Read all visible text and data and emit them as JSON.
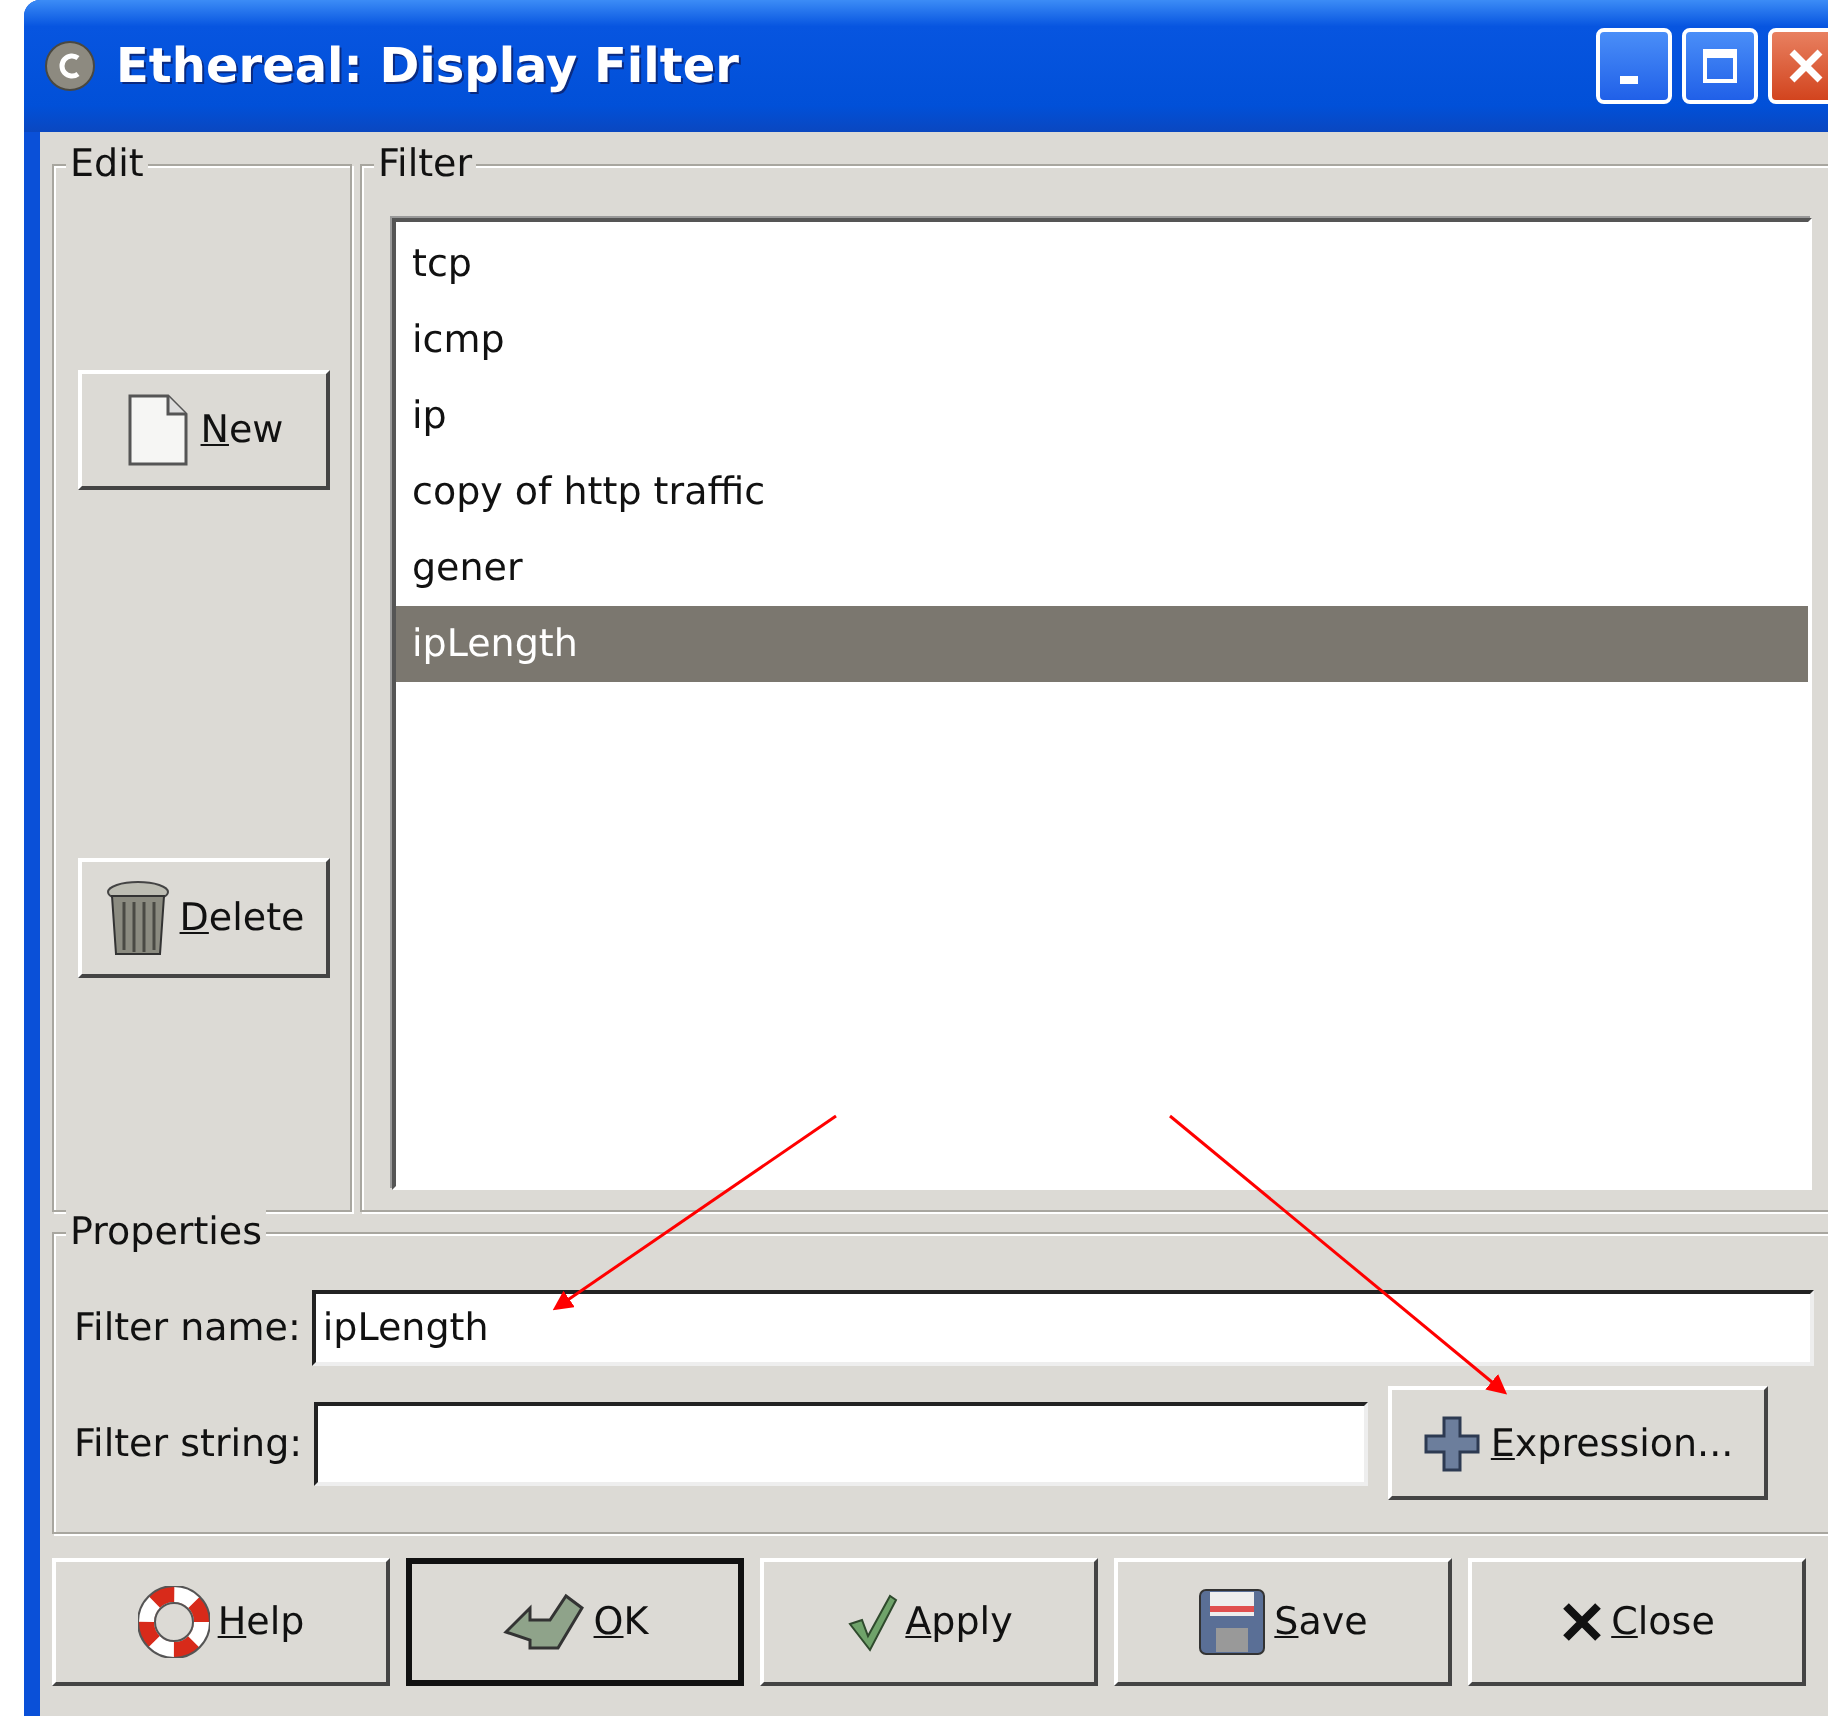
{
  "window": {
    "title": "Ethereal: Display Filter"
  },
  "edit": {
    "title": "Edit",
    "buttons": [
      {
        "label": "New",
        "kind": "new",
        "mnemonic": true
      },
      {
        "label": "Delete",
        "kind": "delete",
        "mnemonic": true
      }
    ]
  },
  "filter": {
    "title": "Filter",
    "items": [
      {
        "label": "tcp",
        "selected": false
      },
      {
        "label": "icmp",
        "selected": false
      },
      {
        "label": "ip",
        "selected": false
      },
      {
        "label": "copy of http traffic",
        "selected": false
      },
      {
        "label": "gener",
        "selected": false
      },
      {
        "label": "ipLength",
        "selected": true
      }
    ]
  },
  "properties": {
    "title": "Properties",
    "name_label": "Filter name:",
    "name_value": "ipLength",
    "string_label": "Filter string:",
    "expression_button": {
      "label": "Expression...",
      "mnemonic": true
    }
  },
  "buttons": [
    {
      "label": "Help",
      "kind": "help",
      "mnemonic": true,
      "default": false
    },
    {
      "label": "OK",
      "kind": "ok",
      "mnemonic": true,
      "default": true
    },
    {
      "label": "Apply",
      "kind": "apply",
      "mnemonic": true,
      "default": false
    },
    {
      "label": "Save",
      "kind": "save",
      "mnemonic": true,
      "default": false
    },
    {
      "label": "Close",
      "kind": "close",
      "mnemonic": true,
      "default": false
    }
  ]
}
